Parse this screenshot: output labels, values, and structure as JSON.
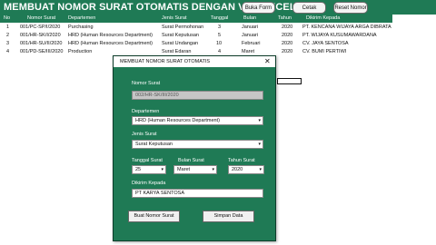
{
  "app": {
    "title": "MEMBUAT NOMOR SURAT OTOMATIS DENGAN VBA EXCEL"
  },
  "toolbar": {
    "buka_form": "Buka Form",
    "cetak": "Cetak",
    "reset_nomor": "Reset Nomor"
  },
  "table": {
    "headers": [
      "No",
      "Nomor Surat",
      "Departemen",
      "Jenis Surat",
      "Tanggal",
      "Bulan",
      "Tahun",
      "Dikirim Kepada"
    ],
    "rows": [
      [
        "1",
        "001/PC-SP/I/2020",
        "Purchasing",
        "Surat Permohonan",
        "3",
        "Januari",
        "2020",
        "PT. KENCANA WIJAYA ARGA DIBRATA"
      ],
      [
        "2",
        "001/HR-SK/I/2020",
        "HRD (Human Resources Department)",
        "Surat Keputusan",
        "5",
        "Januari",
        "2020",
        "PT. WIJAYA KUSUMAWARDANA"
      ],
      [
        "3",
        "001/HR-SU/II/2020",
        "HRD (Human Resources Department)",
        "Surat Undangan",
        "10",
        "Februari",
        "2020",
        "CV. JAYA SENTOSA"
      ],
      [
        "4",
        "001/PD-SE/III/2020",
        "Production",
        "Surat Edaran",
        "4",
        "Maret",
        "2020",
        "CV. BUMI PERTIWI"
      ]
    ]
  },
  "dialog": {
    "title": "MEMBUAT NOMOR SURAT OTOMATIS",
    "close_glyph": "✕",
    "nomor_label": "Nomor Surat",
    "nomor_value": "002/HR-SK/III/2020",
    "departemen_label": "Departemen",
    "departemen_value": "HRD (Human Resources Department)",
    "jenis_label": "Jenis Surat",
    "jenis_value": "Surat Keputusan",
    "tanggal_label": "Tanggal Surat",
    "tanggal_value": "25",
    "bulan_label": "Bulan Surat",
    "bulan_value": "Maret",
    "tahun_label": "Tahun Surat",
    "tahun_value": "2020",
    "dikirim_label": "Dikirim Kepada",
    "dikirim_value": "PT KARYA SENTOSA",
    "dropdown_glyph": "▾",
    "buat_button": "Buat Nomor Surat",
    "simpan_button": "Simpan Data"
  },
  "colors": {
    "accent": "#1f7a55"
  }
}
